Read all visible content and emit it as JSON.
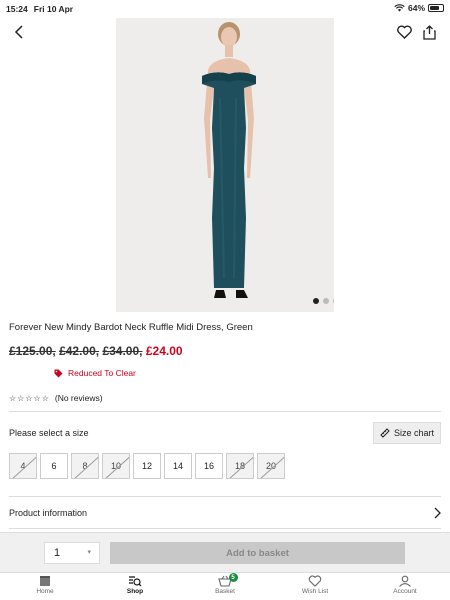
{
  "status": {
    "time": "15:24",
    "date": "Fri 10 Apr",
    "battery": "64%"
  },
  "icons": {
    "back": "chevron-left-icon",
    "wishlist": "heart-icon",
    "share": "share-icon"
  },
  "gallery": {
    "image_count": 4,
    "active_index": 0
  },
  "product": {
    "title": "Forever New Mindy Bardot Neck Ruffle Midi Dress, Green",
    "old_prices": [
      "£125.00,",
      "£42.00,",
      "£34.00,"
    ],
    "price": "£24.00",
    "badge": "Reduced To Clear",
    "stars": "☆☆☆☆☆",
    "reviews": "(No reviews)"
  },
  "sizes": {
    "label": "Please select a size",
    "chart_label": "Size chart",
    "options": [
      {
        "label": "4",
        "available": false
      },
      {
        "label": "6",
        "available": true
      },
      {
        "label": "8",
        "available": false
      },
      {
        "label": "10",
        "available": false
      },
      {
        "label": "12",
        "available": true
      },
      {
        "label": "14",
        "available": true
      },
      {
        "label": "16",
        "available": true
      },
      {
        "label": "18",
        "available": false
      },
      {
        "label": "20",
        "available": false
      }
    ]
  },
  "product_info": {
    "label": "Product information"
  },
  "cart": {
    "quantity": "1",
    "add_label": "Add to basket"
  },
  "tabs": [
    {
      "label": "Home",
      "icon": "home-icon"
    },
    {
      "label": "Shop",
      "icon": "shop-search-icon",
      "active": true
    },
    {
      "label": "Basket",
      "icon": "basket-icon",
      "badge": "5"
    },
    {
      "label": "Wish List",
      "icon": "heart-icon"
    },
    {
      "label": "Account",
      "icon": "account-icon"
    }
  ],
  "colors": {
    "price_red": "#d0021b",
    "badge_green": "#1a8f3c",
    "dress_teal": "#1f4f5c"
  }
}
